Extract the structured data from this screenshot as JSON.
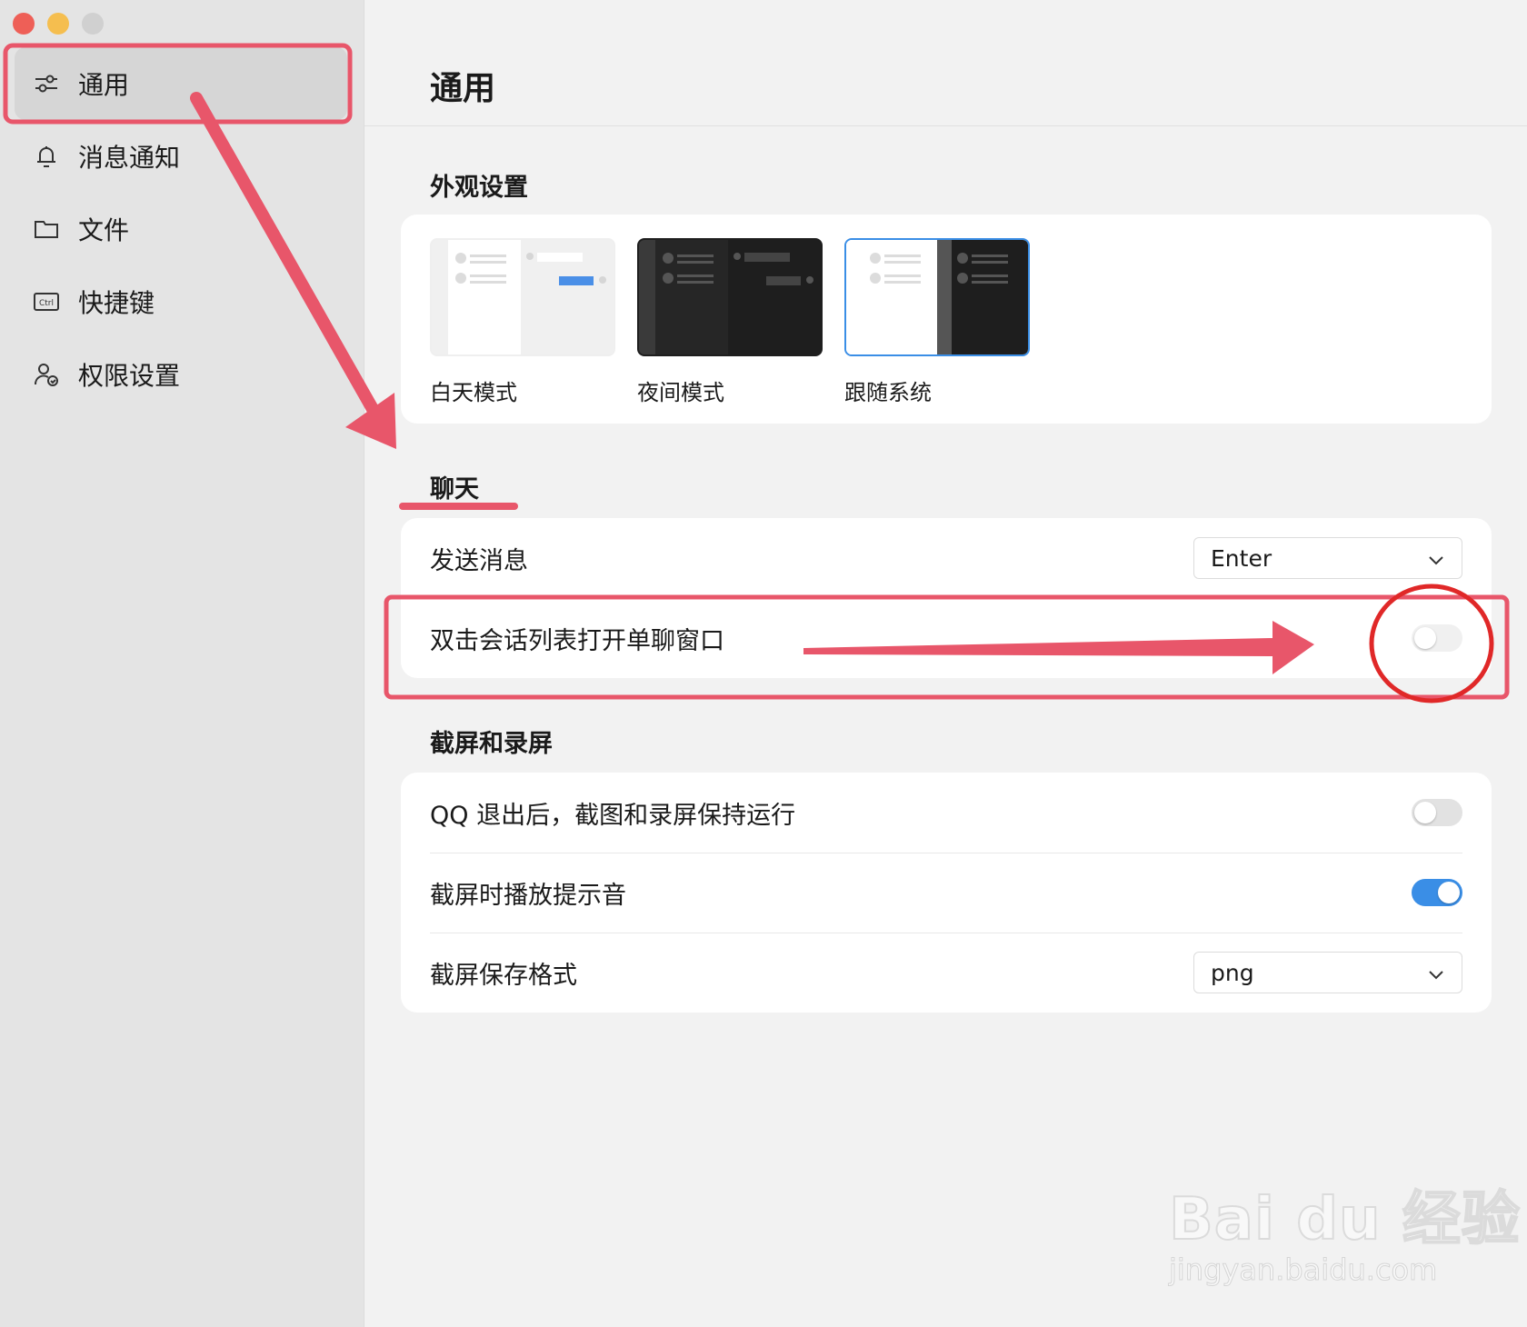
{
  "sidebar": {
    "items": [
      {
        "label": "通用",
        "icon": "sliders-icon",
        "active": true
      },
      {
        "label": "消息通知",
        "icon": "bell-icon",
        "active": false
      },
      {
        "label": "文件",
        "icon": "folder-icon",
        "active": false
      },
      {
        "label": "快捷键",
        "icon": "ctrl-key-icon",
        "active": false
      },
      {
        "label": "权限设置",
        "icon": "user-permission-icon",
        "active": false
      }
    ],
    "ctrl_text": "Ctrl"
  },
  "main": {
    "title": "通用",
    "appearance": {
      "heading": "外观设置",
      "themes": [
        {
          "label": "白天模式",
          "selected": false
        },
        {
          "label": "夜间模式",
          "selected": false
        },
        {
          "label": "跟随系统",
          "selected": true
        }
      ]
    },
    "chat": {
      "heading": "聊天",
      "send_label": "发送消息",
      "send_value": "Enter",
      "dblclick_label": "双击会话列表打开单聊窗口",
      "dblclick_on": false
    },
    "screenshot": {
      "heading": "截屏和录屏",
      "keep_running_label": "QQ 退出后，截图和录屏保持运行",
      "keep_running_on": false,
      "sound_label": "截屏时播放提示音",
      "sound_on": true,
      "format_label": "截屏保存格式",
      "format_value": "png"
    }
  },
  "colors": {
    "accent": "#3a8ee6",
    "annotation": "#e8566a",
    "annotation_circle": "#e02828"
  },
  "watermark": {
    "brand": "Bai du 经验",
    "url": "jingyan.baidu.com"
  }
}
